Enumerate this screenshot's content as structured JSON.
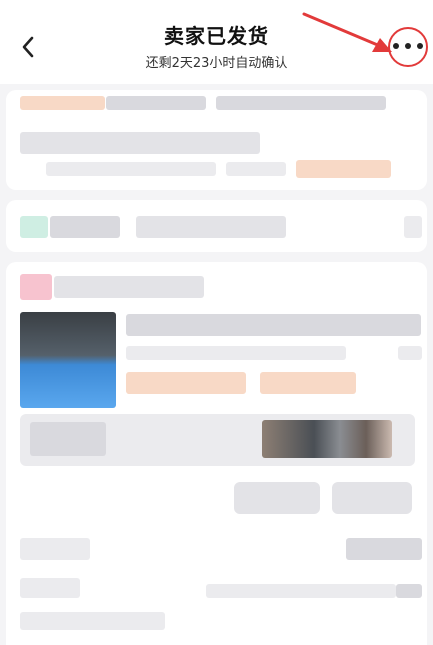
{
  "header": {
    "title": "卖家已发货",
    "subtitle": "还剩2天23小时自动确认",
    "back_icon": "chevron-left-icon",
    "more_icon": "more-horizontal-icon",
    "annotation": {
      "color": "#e23a3a",
      "shape": "circle-and-arrow"
    }
  }
}
